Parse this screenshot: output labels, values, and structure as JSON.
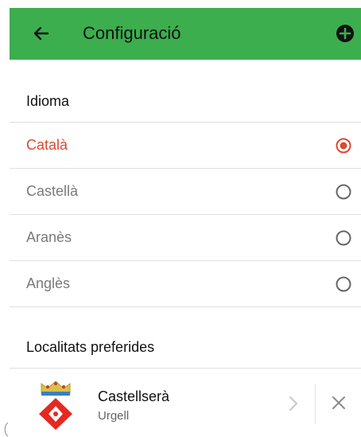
{
  "header": {
    "title": "Configuració",
    "back_icon": "arrow-left-icon",
    "add_icon": "plus-circle-icon",
    "accent_color": "#3cae4e"
  },
  "language_section": {
    "title": "Idioma",
    "options": [
      {
        "label": "Català",
        "selected": true
      },
      {
        "label": "Castellà",
        "selected": false
      },
      {
        "label": "Aranès",
        "selected": false
      },
      {
        "label": "Anglès",
        "selected": false
      }
    ],
    "selected_color": "#d94a33"
  },
  "favorites_section": {
    "title": "Localitats preferides",
    "items": [
      {
        "name": "Castellserà",
        "region": "Urgell",
        "icon": "municipality-crest-icon"
      }
    ]
  }
}
